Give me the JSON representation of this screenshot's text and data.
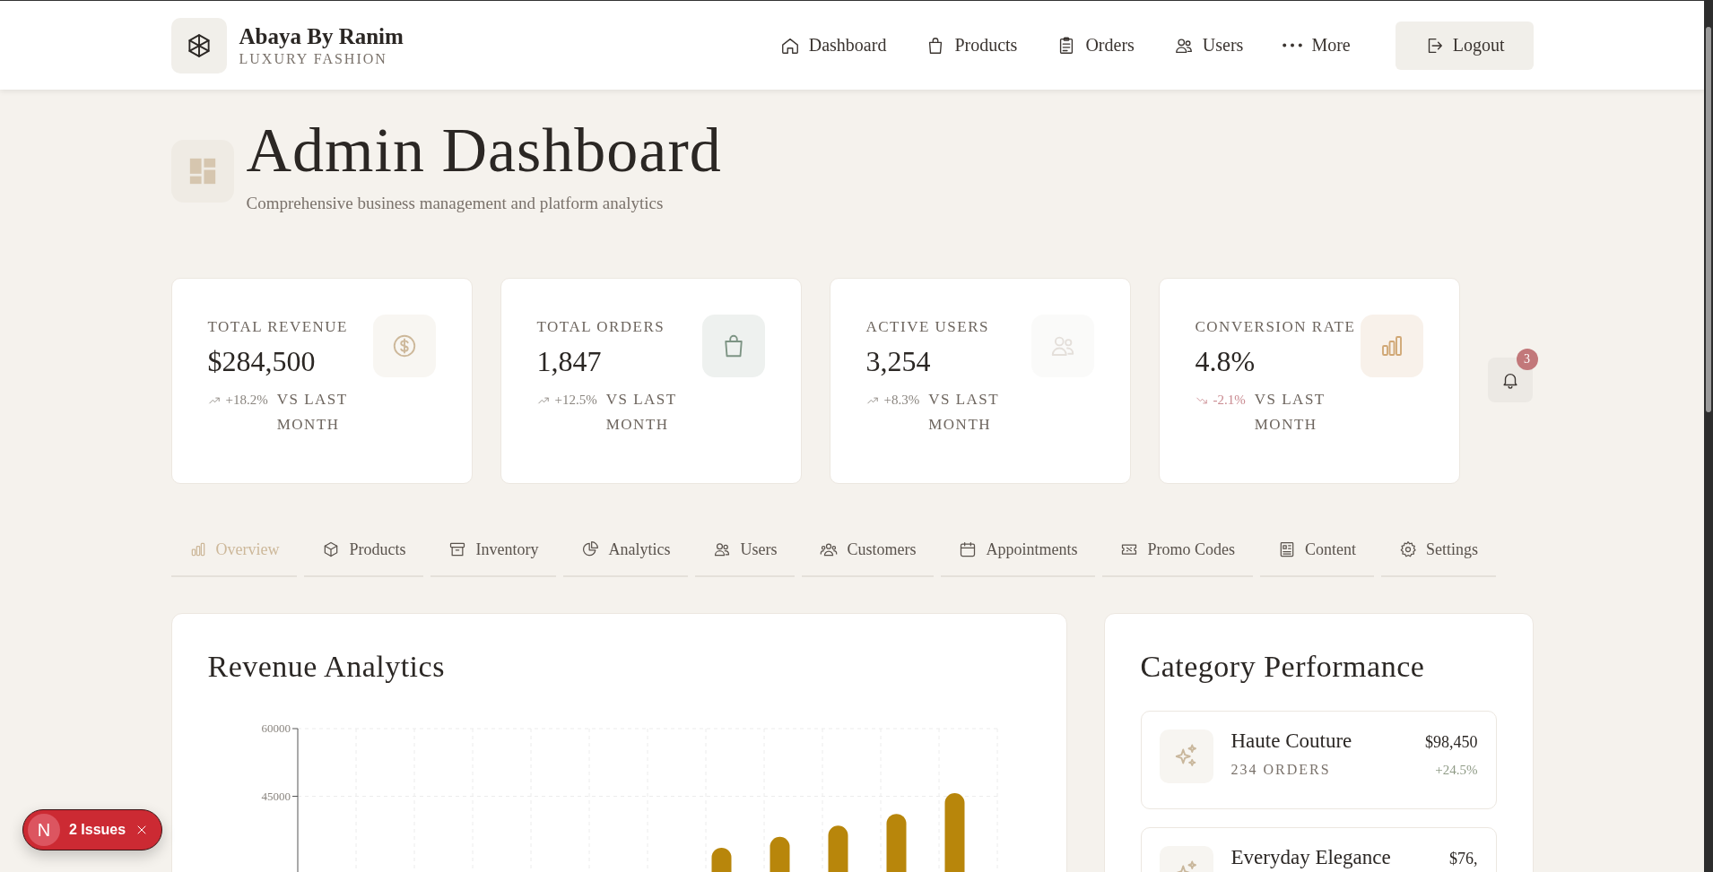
{
  "brand": {
    "name": "Abaya By Ranim",
    "tagline": "LUXURY FASHION"
  },
  "nav": [
    {
      "label": "Dashboard"
    },
    {
      "label": "Products"
    },
    {
      "label": "Orders"
    },
    {
      "label": "Users"
    },
    {
      "label": "More"
    }
  ],
  "logout": "Logout",
  "page": {
    "title": "Admin Dashboard",
    "subtitle": "Comprehensive business management and platform analytics"
  },
  "stats": [
    {
      "label": "TOTAL REVENUE",
      "value": "$284,500",
      "change": "+18.2%",
      "kind": "up",
      "note": "VS LAST MONTH"
    },
    {
      "label": "TOTAL ORDERS",
      "value": "1,847",
      "change": "+12.5%",
      "kind": "up",
      "note": "VS LAST MONTH"
    },
    {
      "label": "ACTIVE USERS",
      "value": "3,254",
      "change": "+8.3%",
      "kind": "up",
      "note": "VS LAST MONTH"
    },
    {
      "label": "CONVERSION RATE",
      "value": "4.8%",
      "change": "-2.1%",
      "kind": "down",
      "note": "VS LAST MONTH"
    }
  ],
  "notifications": {
    "count": "3"
  },
  "tabs": [
    {
      "label": "Overview",
      "selected": true
    },
    {
      "label": "Products",
      "selected": false
    },
    {
      "label": "Inventory",
      "selected": false
    },
    {
      "label": "Analytics",
      "selected": false
    },
    {
      "label": "Users",
      "selected": false
    },
    {
      "label": "Customers",
      "selected": false
    },
    {
      "label": "Appointments",
      "selected": false
    },
    {
      "label": "Promo Codes",
      "selected": false
    },
    {
      "label": "Content",
      "selected": false
    },
    {
      "label": "Settings",
      "selected": false
    }
  ],
  "revenue": {
    "title": "Revenue Analytics",
    "chart_data": {
      "type": "bar",
      "ylim": [
        0,
        60000
      ],
      "yticks": [
        45000,
        60000
      ],
      "series": [
        {
          "color": "#b8860b",
          "values": [
            null,
            null,
            null,
            null,
            null,
            null,
            null,
            33600,
            36000,
            38500,
            41100,
            45700
          ]
        }
      ]
    }
  },
  "categories": {
    "title": "Category Performance",
    "items": [
      {
        "name": "Haute Couture",
        "orders": "234 ORDERS",
        "amount": "$98,450",
        "change": "+24.5%"
      },
      {
        "name": "Everyday Elegance",
        "amount": "$76,"
      }
    ]
  },
  "issues": {
    "badge": "N",
    "label": "2 Issues"
  }
}
